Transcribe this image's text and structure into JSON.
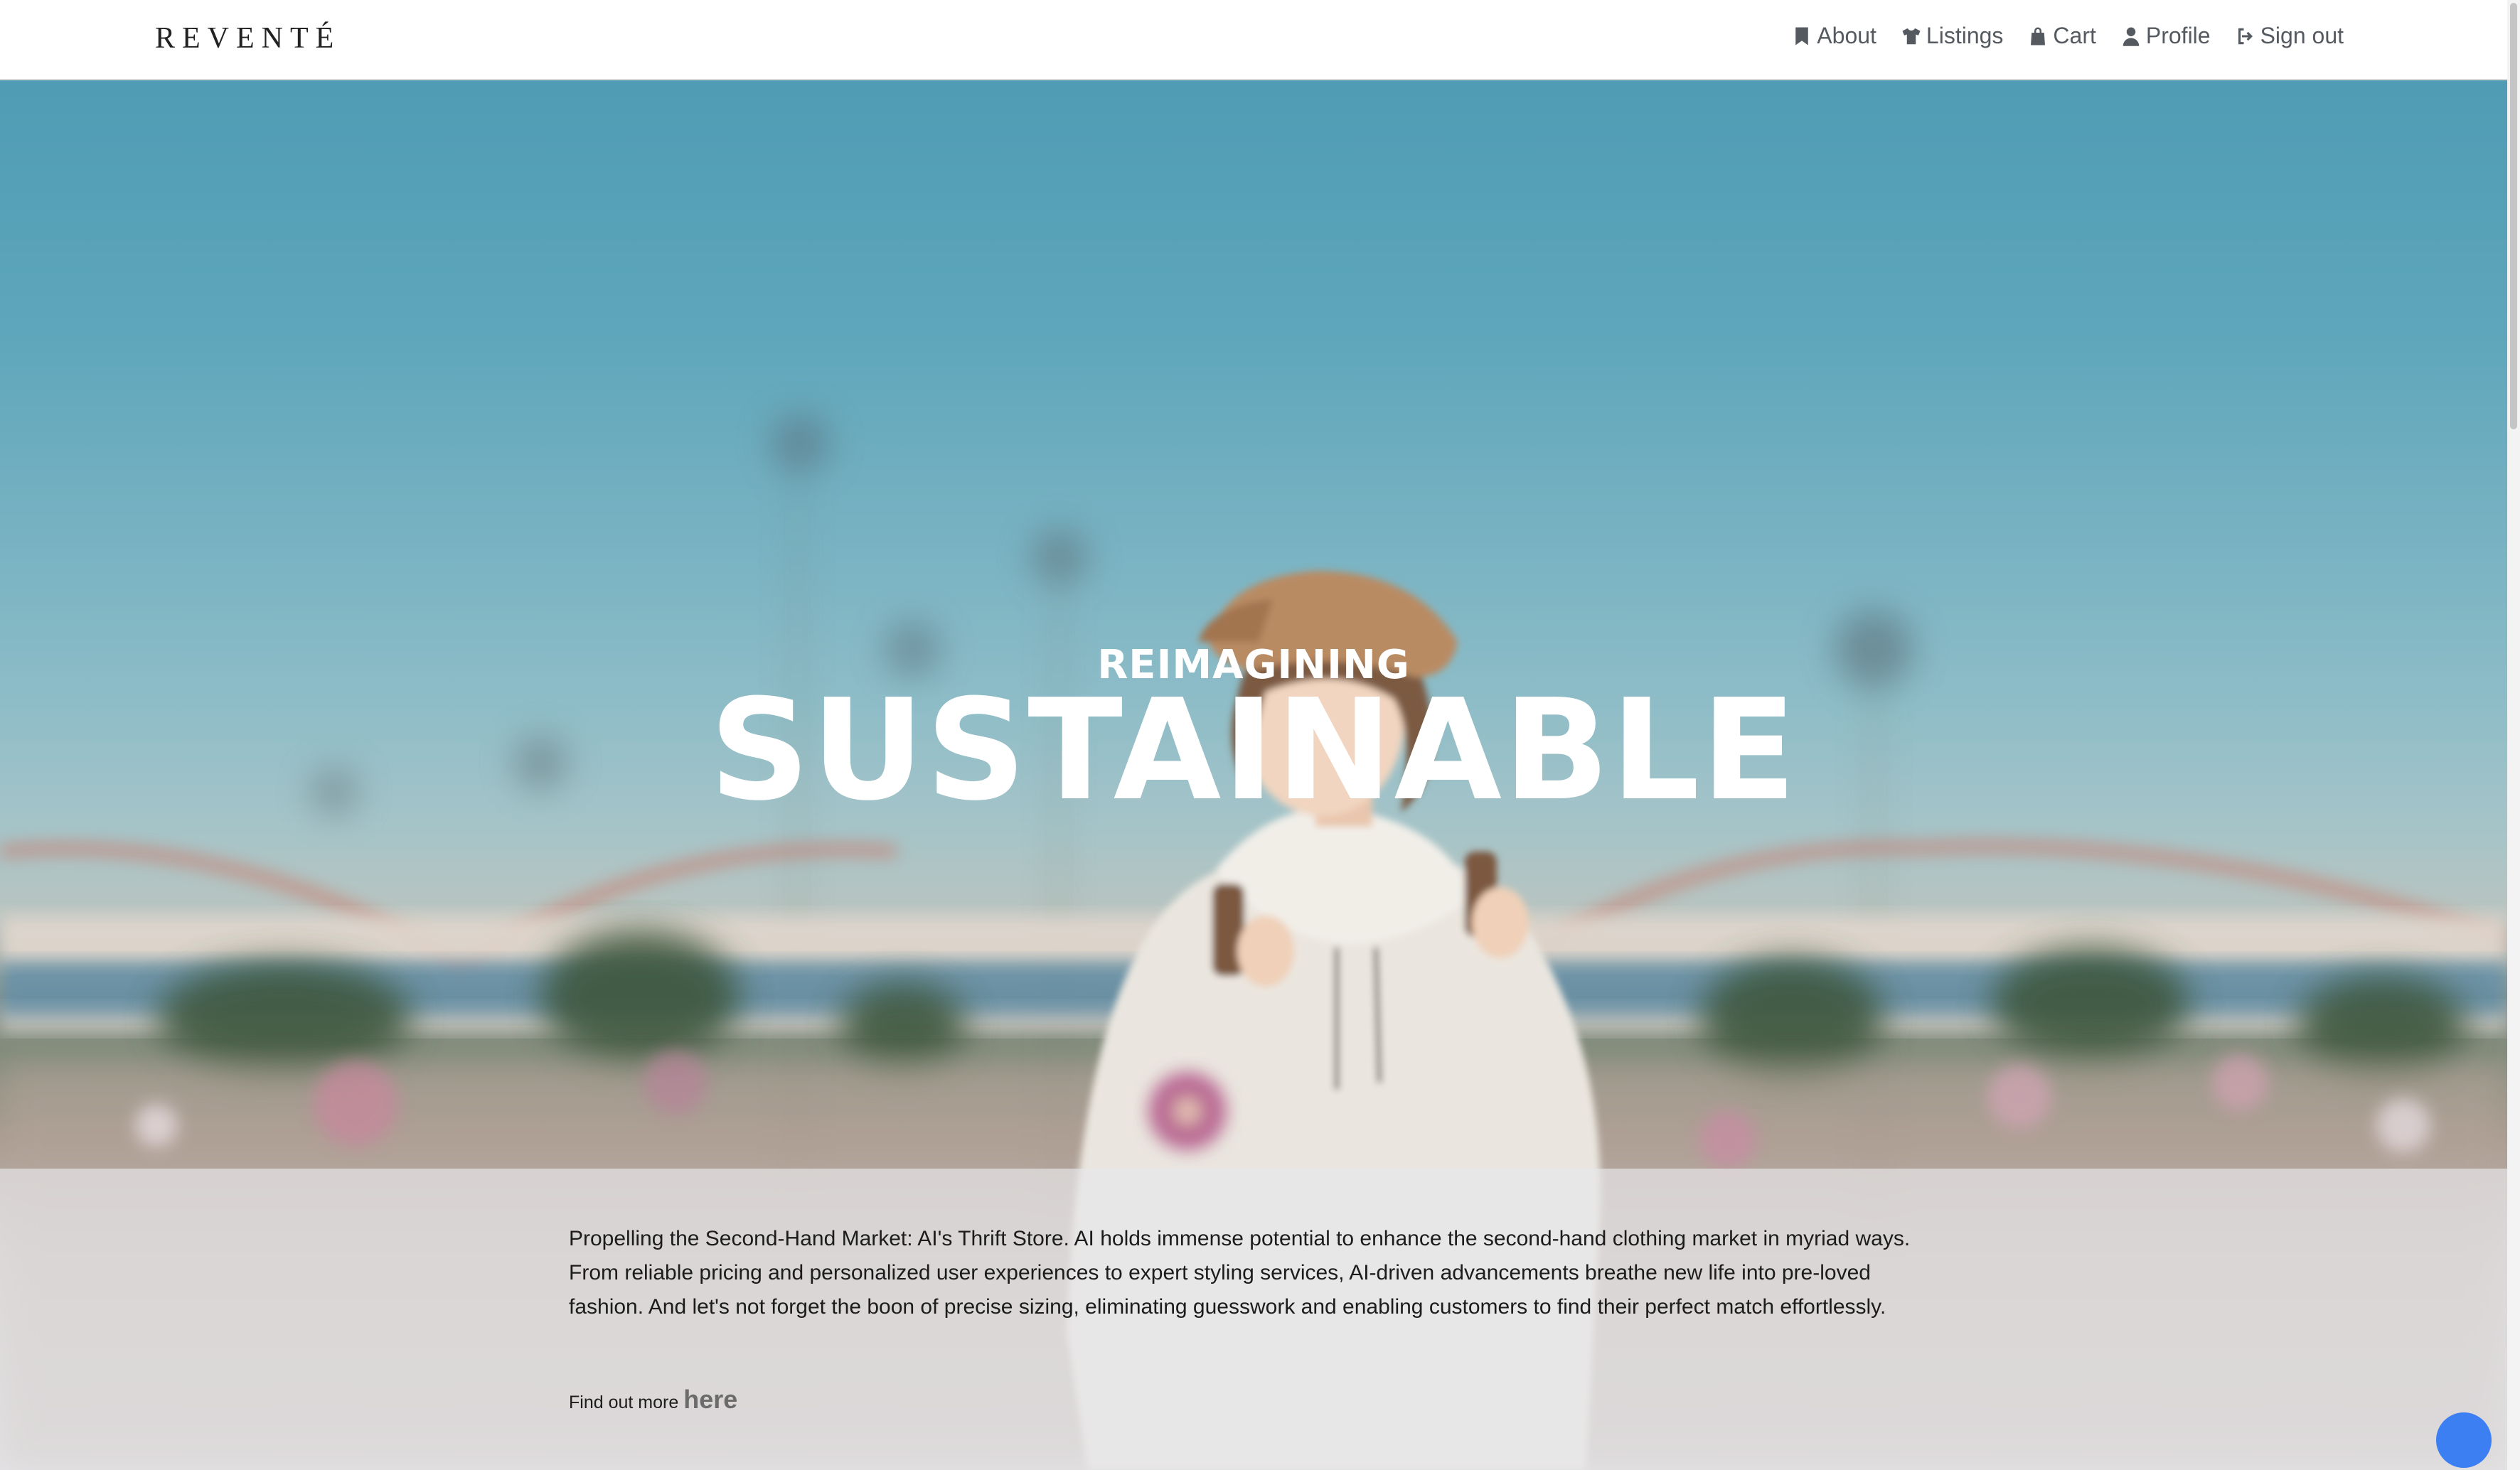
{
  "brand": {
    "name": "REVENTÉ"
  },
  "nav": {
    "items": [
      {
        "label": "About",
        "icon": "bookmark-icon"
      },
      {
        "label": "Listings",
        "icon": "shirt-icon"
      },
      {
        "label": "Cart",
        "icon": "shopping-bag-icon"
      },
      {
        "label": "Profile",
        "icon": "user-icon"
      },
      {
        "label": "Sign out",
        "icon": "sign-out-icon"
      }
    ]
  },
  "hero": {
    "subtitle": "REIMAGINING",
    "title": "SUSTAINABLE"
  },
  "info": {
    "paragraph": "Propelling the Second-Hand Market: AI's Thrift Store. AI holds immense potential to enhance the second-hand clothing market in myriad ways. From reliable pricing and personalized user experiences to expert styling services, AI-driven advancements breathe new life into pre-loved fashion. And let's not forget the boon of precise sizing, eliminating guesswork and enabling customers to find their perfect match effortlessly.",
    "find_more_prefix": "Find out more",
    "find_more_link": "here"
  },
  "colors": {
    "accent": "#3b7ff2",
    "nav_text": "#555a60",
    "hero_sky": "#5ea6bb"
  }
}
